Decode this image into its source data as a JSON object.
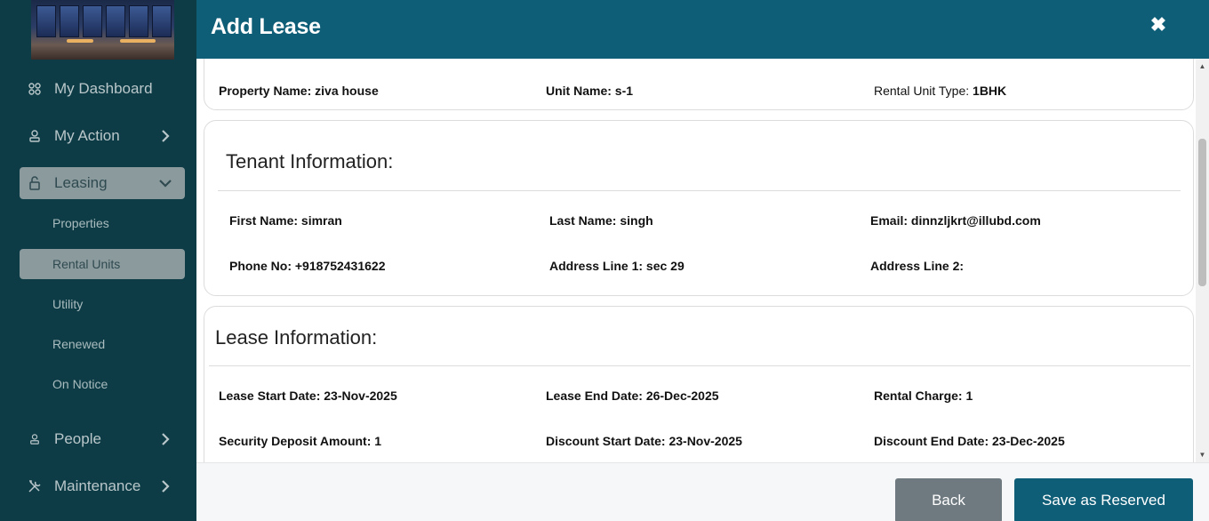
{
  "sidebar": {
    "items": [
      {
        "label": "My Dashboard",
        "icon": "grid-icon"
      },
      {
        "label": "My Action",
        "icon": "person-icon"
      },
      {
        "label": "Leasing",
        "icon": "lock-icon"
      },
      {
        "label": "People",
        "icon": "person-icon"
      },
      {
        "label": "Maintenance",
        "icon": "tools-icon"
      }
    ],
    "leasing_sub": [
      "Properties",
      "Rental Units",
      "Utility",
      "Renewed",
      "On Notice"
    ]
  },
  "modal": {
    "title": "Add Lease",
    "property": {
      "name": "Property Name: ziva house",
      "unit": "Unit Name: s-1",
      "type_label": "Rental Unit Type: ",
      "type_value": "1BHK"
    },
    "tenant": {
      "heading": "Tenant Information:",
      "first_name": "First Name: simran",
      "last_name": "Last Name: singh",
      "email": "Email: dinnzljkrt@illubd.com",
      "phone": "Phone No: +918752431622",
      "address1": "Address Line 1: sec 29",
      "address2": "Address Line 2:"
    },
    "lease": {
      "heading": "Lease Information:",
      "start": "Lease Start Date: 23-Nov-2025",
      "end": "Lease End Date: 26-Dec-2025",
      "charge": "Rental Charge: 1",
      "deposit": "Security Deposit Amount: 1",
      "discount_start": "Discount Start Date: 23-Nov-2025",
      "discount_end": "Discount End Date: 23-Dec-2025"
    },
    "buttons": {
      "back": "Back",
      "save": "Save as Reserved"
    }
  },
  "colors": {
    "header": "#0f5e78",
    "sidebar": "#0e3c46",
    "active": "#8b9a9d"
  }
}
